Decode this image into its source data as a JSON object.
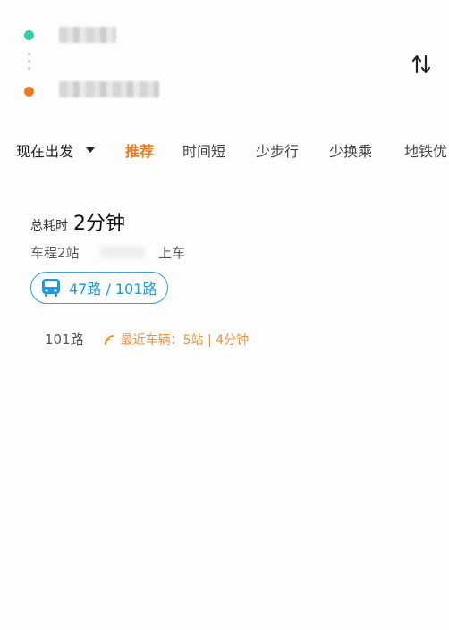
{
  "route": {
    "origin_color": "#2fd1a8",
    "destination_color": "#f07a1b",
    "swap_icon": "swap-vertical-icon"
  },
  "filters": {
    "depart_label": "现在出发",
    "tabs": [
      {
        "label": "推荐",
        "active": true
      },
      {
        "label": "时间短",
        "active": false
      },
      {
        "label": "少步行",
        "active": false
      },
      {
        "label": "少换乘",
        "active": false
      },
      {
        "label": "地铁优",
        "active": false
      }
    ]
  },
  "result": {
    "total_label": "总耗时",
    "total_value": "2分钟",
    "ride_info": "车程2站",
    "board_label": "上车",
    "lines_label": "47路 / 101路",
    "realtime": {
      "line": "101路",
      "info": "最近车辆：5站 | 4分钟"
    }
  },
  "colors": {
    "accent": "#f07a1b",
    "bus_blue": "#1e97dc",
    "realtime_orange": "#e8913a"
  }
}
